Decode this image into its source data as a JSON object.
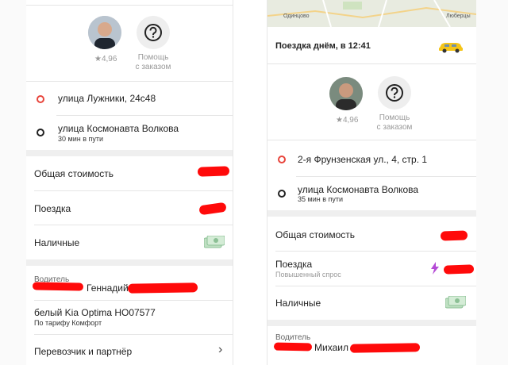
{
  "left": {
    "driver": {
      "rating": "★4,96"
    },
    "help": {
      "line1": "Помощь",
      "line2": "с заказом"
    },
    "route": {
      "from": "улица Лужники, 24с48",
      "to": "улица Космонавта Волкова",
      "duration": "30 мин в пути"
    },
    "cost": {
      "total_label": "Общая стоимость",
      "trip_label": "Поездка",
      "payment_label": "Наличные"
    },
    "driver_info": {
      "label": "Водитель",
      "name": "Геннадий",
      "car": "белый Kia Optima HO07577",
      "tariff": "По тарифу Комфорт",
      "carrier": "Перевозчик и партнёр"
    }
  },
  "right": {
    "map": {
      "place1": "Одинцово",
      "place2": "Люберцы"
    },
    "trip_title": "Поездка днём, в 12:41",
    "driver": {
      "rating": "★4,96"
    },
    "help": {
      "line1": "Помощь",
      "line2": "с заказом"
    },
    "route": {
      "from": "2-я Фрунзенская ул., 4, стр. 1",
      "to": "улица Космонавта Волкова",
      "duration": "35 мин в пути"
    },
    "cost": {
      "total_label": "Общая стоимость",
      "trip_label": "Поездка",
      "trip_note": "Повышенный спрос",
      "payment_label": "Наличные"
    },
    "driver_info": {
      "label": "Водитель",
      "name": "Михаил"
    }
  },
  "icons": {
    "help": "question-circle-icon",
    "cash": "cash-icon",
    "surge": "lightning-icon",
    "chevron": "chevron-right-icon",
    "taxi": "taxi-car-icon"
  },
  "colors": {
    "accent_red": "#e8453c",
    "redaction": "#ff0a0a",
    "surge": "#b44ad6",
    "taxi": "#f5c518"
  }
}
